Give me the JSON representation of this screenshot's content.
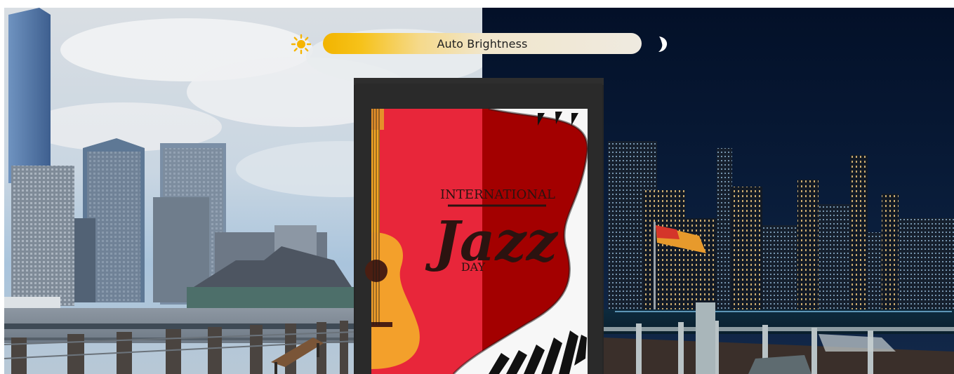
{
  "brightness": {
    "label": "Auto Brightness",
    "day_icon": "sun-icon",
    "night_icon": "moon-icon",
    "accent_color": "#f2b400",
    "level": 0.5
  },
  "poster": {
    "line1": "INTERNATIONAL",
    "line2": "Jazz",
    "line3": "DAY",
    "colors": {
      "red": "#e8263a",
      "dark_red": "#a30000",
      "frame": "#262626"
    }
  },
  "scene": {
    "left_mode": "day",
    "right_mode": "night"
  }
}
